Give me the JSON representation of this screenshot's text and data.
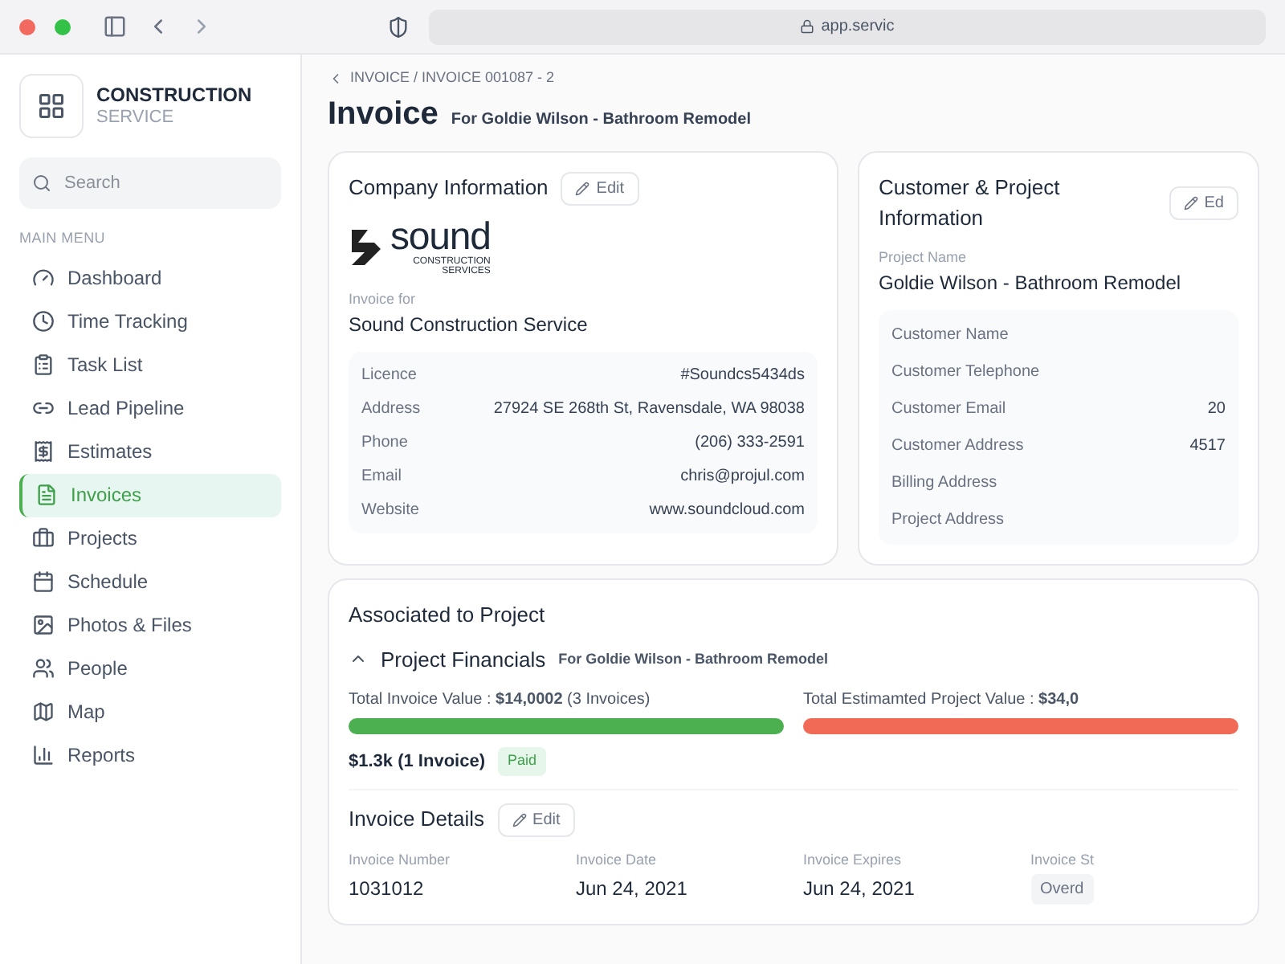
{
  "browser": {
    "address": "app.servic"
  },
  "sidebar": {
    "brand_title": "CONSTRUCTION",
    "brand_subtitle": "SERVICE",
    "search": {
      "placeholder": "Search"
    },
    "section_label": "MAIN MENU",
    "items": [
      {
        "label": "Dashboard",
        "selected": false
      },
      {
        "label": "Time Tracking",
        "selected": false
      },
      {
        "label": "Task List",
        "selected": false
      },
      {
        "label": "Lead Pipeline",
        "selected": false
      },
      {
        "label": "Estimates",
        "selected": false
      },
      {
        "label": "Invoices",
        "selected": true
      },
      {
        "label": "Projects",
        "selected": false
      },
      {
        "label": "Schedule",
        "selected": false
      },
      {
        "label": "Photos & Files",
        "selected": false
      },
      {
        "label": "People",
        "selected": false
      },
      {
        "label": "Map",
        "selected": false
      },
      {
        "label": "Reports",
        "selected": false
      }
    ]
  },
  "header": {
    "breadcrumb": "INVOICE / INVOICE 001087 - 2",
    "title": "Invoice",
    "subtitle": "For Goldie Wilson - Bathroom Remodel"
  },
  "company_card": {
    "title": "Company Information",
    "edit_label": "Edit",
    "logo_word": "sound",
    "logo_line_1": "CONSTRUCTION",
    "logo_line_2": "SERVICES",
    "invoice_for_label": "Invoice for",
    "invoice_for": "Sound Construction Service",
    "rows": [
      {
        "label": "Licence",
        "value": "#Soundcs5434ds"
      },
      {
        "label": "Address",
        "value": "27924 SE 268th St, Ravensdale, WA 98038"
      },
      {
        "label": "Phone",
        "value": "(206) 333-2591"
      },
      {
        "label": "Email",
        "value": "chris@projul.com"
      },
      {
        "label": "Website",
        "value": "www.soundcloud.com"
      }
    ]
  },
  "customer_card": {
    "title": "Customer & Project Information",
    "edit_label": "Ed",
    "project_name_label": "Project Name",
    "project_name": "Goldie Wilson - Bathroom Remodel",
    "rows": [
      {
        "label": "Customer Name"
      },
      {
        "label": "Customer Telephone"
      },
      {
        "label": "Customer Email",
        "value": "20"
      },
      {
        "label": "Customer Address",
        "value": "4517"
      },
      {
        "label": "Billing Address"
      },
      {
        "label": "Project Address"
      }
    ]
  },
  "associated": {
    "title": "Associated to Project",
    "financials_title": "Project Financials",
    "financials_subtitle": "For Goldie Wilson - Bathroom Remodel",
    "expanded": true,
    "bars": [
      {
        "label": "Total Invoice Value : **$14,0002** (3 Invoices)",
        "color": "#4caf50"
      },
      {
        "label": "Total Estimamted Project Value : **$34,0**",
        "color": "#f06a55"
      }
    ],
    "paid_amount": "$1.3k (1 Invoice)",
    "paid_badge": "Paid",
    "details_title": "Invoice Details",
    "details_edit_label": "Edit",
    "fields": [
      {
        "label": "Invoice Number",
        "value": "1031012"
      },
      {
        "label": "Invoice Date",
        "value": "Jun 24, 2021"
      },
      {
        "label": "Invoice Expires",
        "value": "Jun 24, 2021"
      },
      {
        "label": "Invoice St",
        "value": "Overd",
        "kind": "badge"
      }
    ]
  }
}
